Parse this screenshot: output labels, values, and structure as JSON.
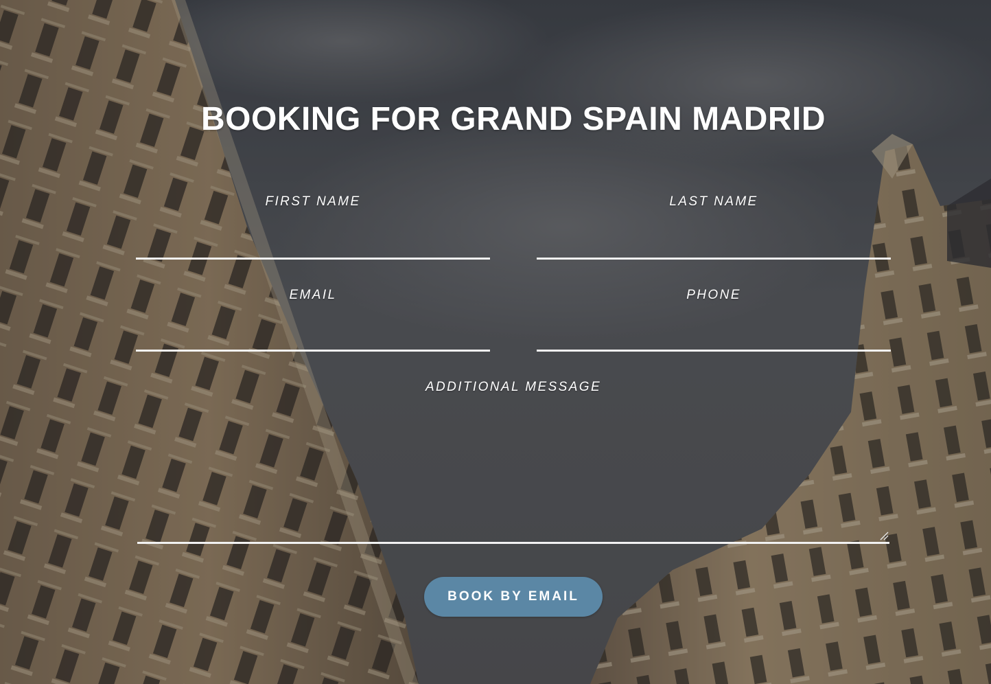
{
  "colors": {
    "button_background": "#5b87a5",
    "text": "#ffffff",
    "underline": "#f2f2f2",
    "overlay": "#28282a"
  },
  "background": {
    "icon": "city-buildings-photo"
  },
  "form": {
    "title": "BOOKING FOR GRAND SPAIN MADRID",
    "first_name_label": "FIRST NAME",
    "first_name_value": "",
    "last_name_label": "LAST NAME",
    "last_name_value": "",
    "email_label": "EMAIL",
    "email_value": "",
    "phone_label": "PHONE",
    "phone_value": "",
    "message_label": "ADDITIONAL MESSAGE",
    "message_value": "",
    "submit_label": "BOOK BY EMAIL"
  }
}
